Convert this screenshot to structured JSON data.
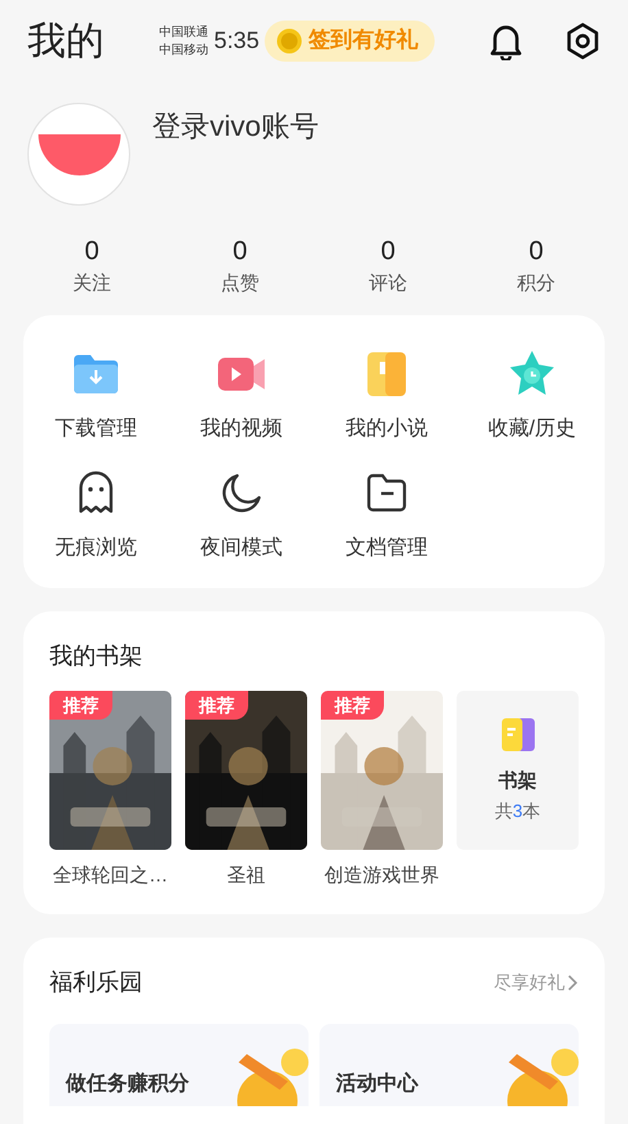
{
  "header": {
    "title": "我的",
    "carriers": [
      "中国联通",
      "中国移动"
    ],
    "time": "5:35",
    "promo": "签到有好礼"
  },
  "profile": {
    "login": "登录vivo账号"
  },
  "stats": [
    {
      "value": "0",
      "label": "关注"
    },
    {
      "value": "0",
      "label": "点赞"
    },
    {
      "value": "0",
      "label": "评论"
    },
    {
      "value": "0",
      "label": "积分"
    }
  ],
  "tools": [
    {
      "label": "下载管理",
      "kind": "download"
    },
    {
      "label": "我的视频",
      "kind": "video"
    },
    {
      "label": "我的小说",
      "kind": "novel"
    },
    {
      "label": "收藏/历史",
      "kind": "star"
    },
    {
      "label": "无痕浏览",
      "kind": "ghost"
    },
    {
      "label": "夜间模式",
      "kind": "moon"
    },
    {
      "label": "文档管理",
      "kind": "folder"
    }
  ],
  "bookshelf": {
    "title": "我的书架",
    "books": [
      {
        "badge": "推荐",
        "title": "全球轮回之…",
        "kind": "picture"
      },
      {
        "badge": "推荐",
        "title": "圣祖",
        "kind": "picture"
      },
      {
        "badge": "推荐",
        "title": "创造游戏世界",
        "kind": "picture"
      }
    ],
    "shelf": {
      "label": "书架",
      "count_prefix": "共",
      "count": "3",
      "count_suffix": "本"
    }
  },
  "welfare": {
    "title": "福利乐园",
    "more": "尽享好礼",
    "cards": [
      {
        "title": "做任务赚积分"
      },
      {
        "title": "活动中心"
      }
    ]
  }
}
